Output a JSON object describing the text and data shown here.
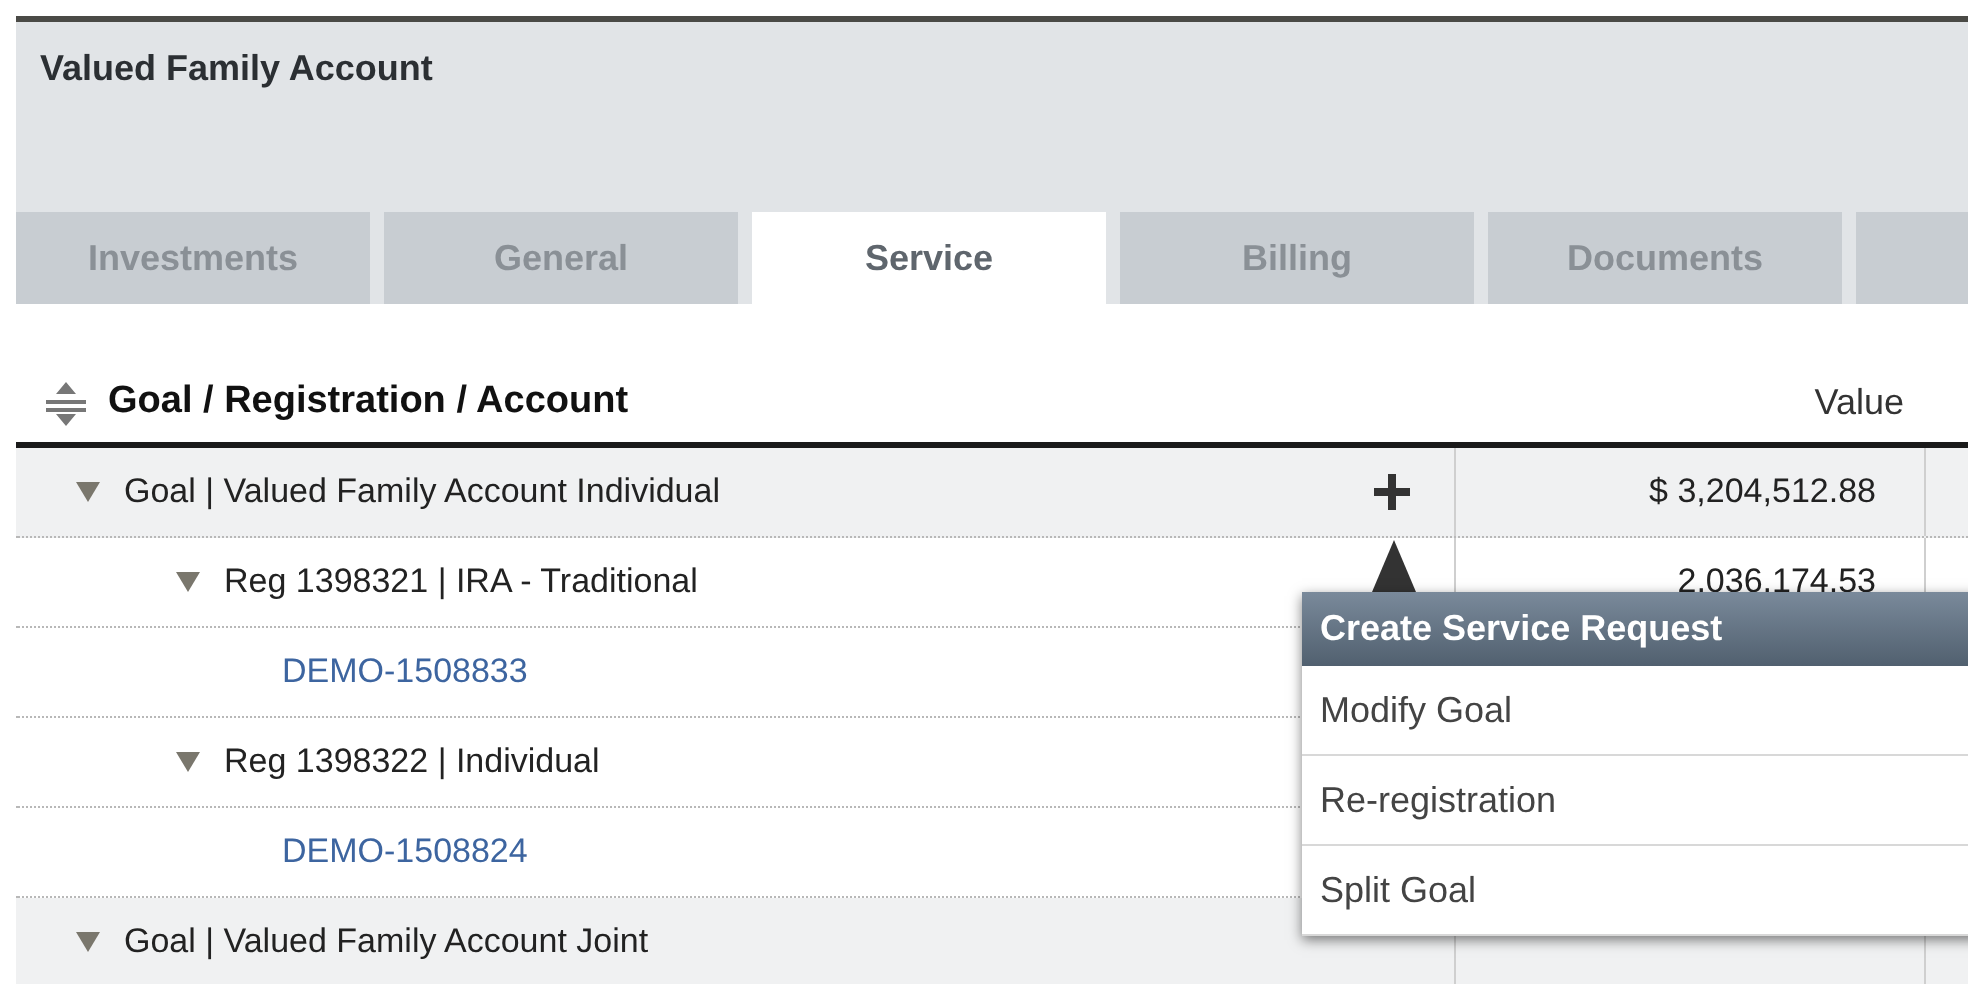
{
  "account": {
    "title": "Valued Family Account"
  },
  "tabs": [
    {
      "label": "Investments",
      "selected": false
    },
    {
      "label": "General",
      "selected": false
    },
    {
      "label": "Service",
      "selected": true
    },
    {
      "label": "Billing",
      "selected": false
    },
    {
      "label": "Documents",
      "selected": false
    }
  ],
  "table": {
    "columns": [
      "Goal / Registration / Account",
      "Value"
    ],
    "rows": [
      {
        "kind": "goal",
        "label": "Goal | Valued Family Account Individual",
        "value": "$ 3,204,512.88",
        "expanded": true,
        "children": [
          {
            "kind": "registration",
            "label": "Reg 1398321 | IRA - Traditional",
            "value": "2,036,174.53",
            "expanded": true,
            "children": [
              {
                "kind": "account",
                "label": "DEMO-1508833"
              }
            ]
          },
          {
            "kind": "registration",
            "label": "Reg 1398322 | Individual",
            "expanded": true,
            "children": [
              {
                "kind": "account",
                "label": "DEMO-1508824"
              }
            ]
          }
        ]
      },
      {
        "kind": "goal",
        "label": "Goal | Valued Family Account Joint",
        "expanded": true
      }
    ]
  },
  "service_menu": {
    "title": "Create Service Request",
    "items": [
      "Modify Goal",
      "Re-registration",
      "Split Goal"
    ]
  }
}
